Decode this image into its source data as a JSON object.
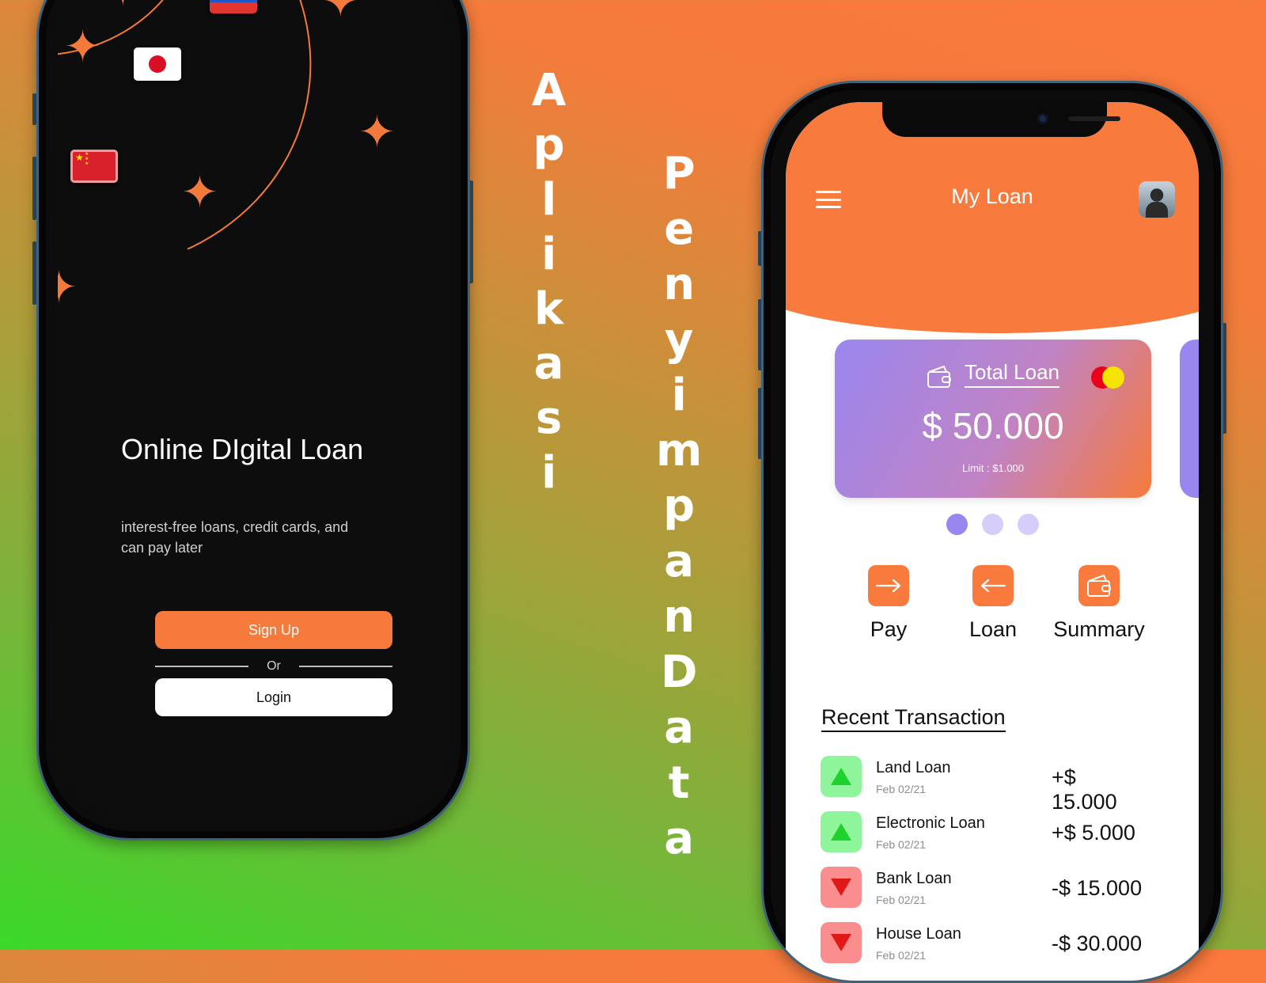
{
  "left_screen": {
    "title": "Online DIgital Loan",
    "subtitle": "interest-free loans, credit cards, and can pay later",
    "signup_label": "Sign Up",
    "or_label": "Or",
    "login_label": "Login",
    "flags": [
      "russia-flag",
      "japan-flag",
      "china-flag"
    ]
  },
  "vertical_text": {
    "word1": [
      "A",
      "p",
      "l",
      "i",
      "k",
      "a",
      "s",
      "i"
    ],
    "word2": [
      "P",
      "e",
      "n",
      "y",
      "i",
      "m",
      "p",
      "a",
      "n",
      "D",
      "a",
      "t",
      "a"
    ]
  },
  "right_screen": {
    "app_title": "My Loan",
    "card": {
      "label": "Total Loan",
      "amount": "$ 50.000",
      "limit": "Limit : $1.000"
    },
    "carousel": {
      "count": 3,
      "active_index": 0
    },
    "actions": [
      {
        "label": "Pay",
        "icon": "arrow-right-icon"
      },
      {
        "label": "Loan",
        "icon": "arrow-left-icon"
      },
      {
        "label": "Summary",
        "icon": "wallet-icon"
      }
    ],
    "recent_title": "Recent Transaction",
    "transactions": [
      {
        "name": "Land Loan",
        "date": "Feb 02/21",
        "amount": "+$ 15.000",
        "direction": "up"
      },
      {
        "name": "Electronic Loan",
        "date": "Feb 02/21",
        "amount": "+$ 5.000",
        "direction": "up"
      },
      {
        "name": "Bank Loan",
        "date": "Feb 02/21",
        "amount": "-$ 15.000",
        "direction": "down"
      },
      {
        "name": "House Loan",
        "date": "Feb 02/21",
        "amount": "-$ 30.000",
        "direction": "down"
      }
    ]
  },
  "colors": {
    "accent": "#f87a3c",
    "card_start": "#9a86ef",
    "up": "#1fd12d",
    "down": "#e01818",
    "mastercard_red": "#eb001b",
    "mastercard_yellow": "#f5e400"
  }
}
